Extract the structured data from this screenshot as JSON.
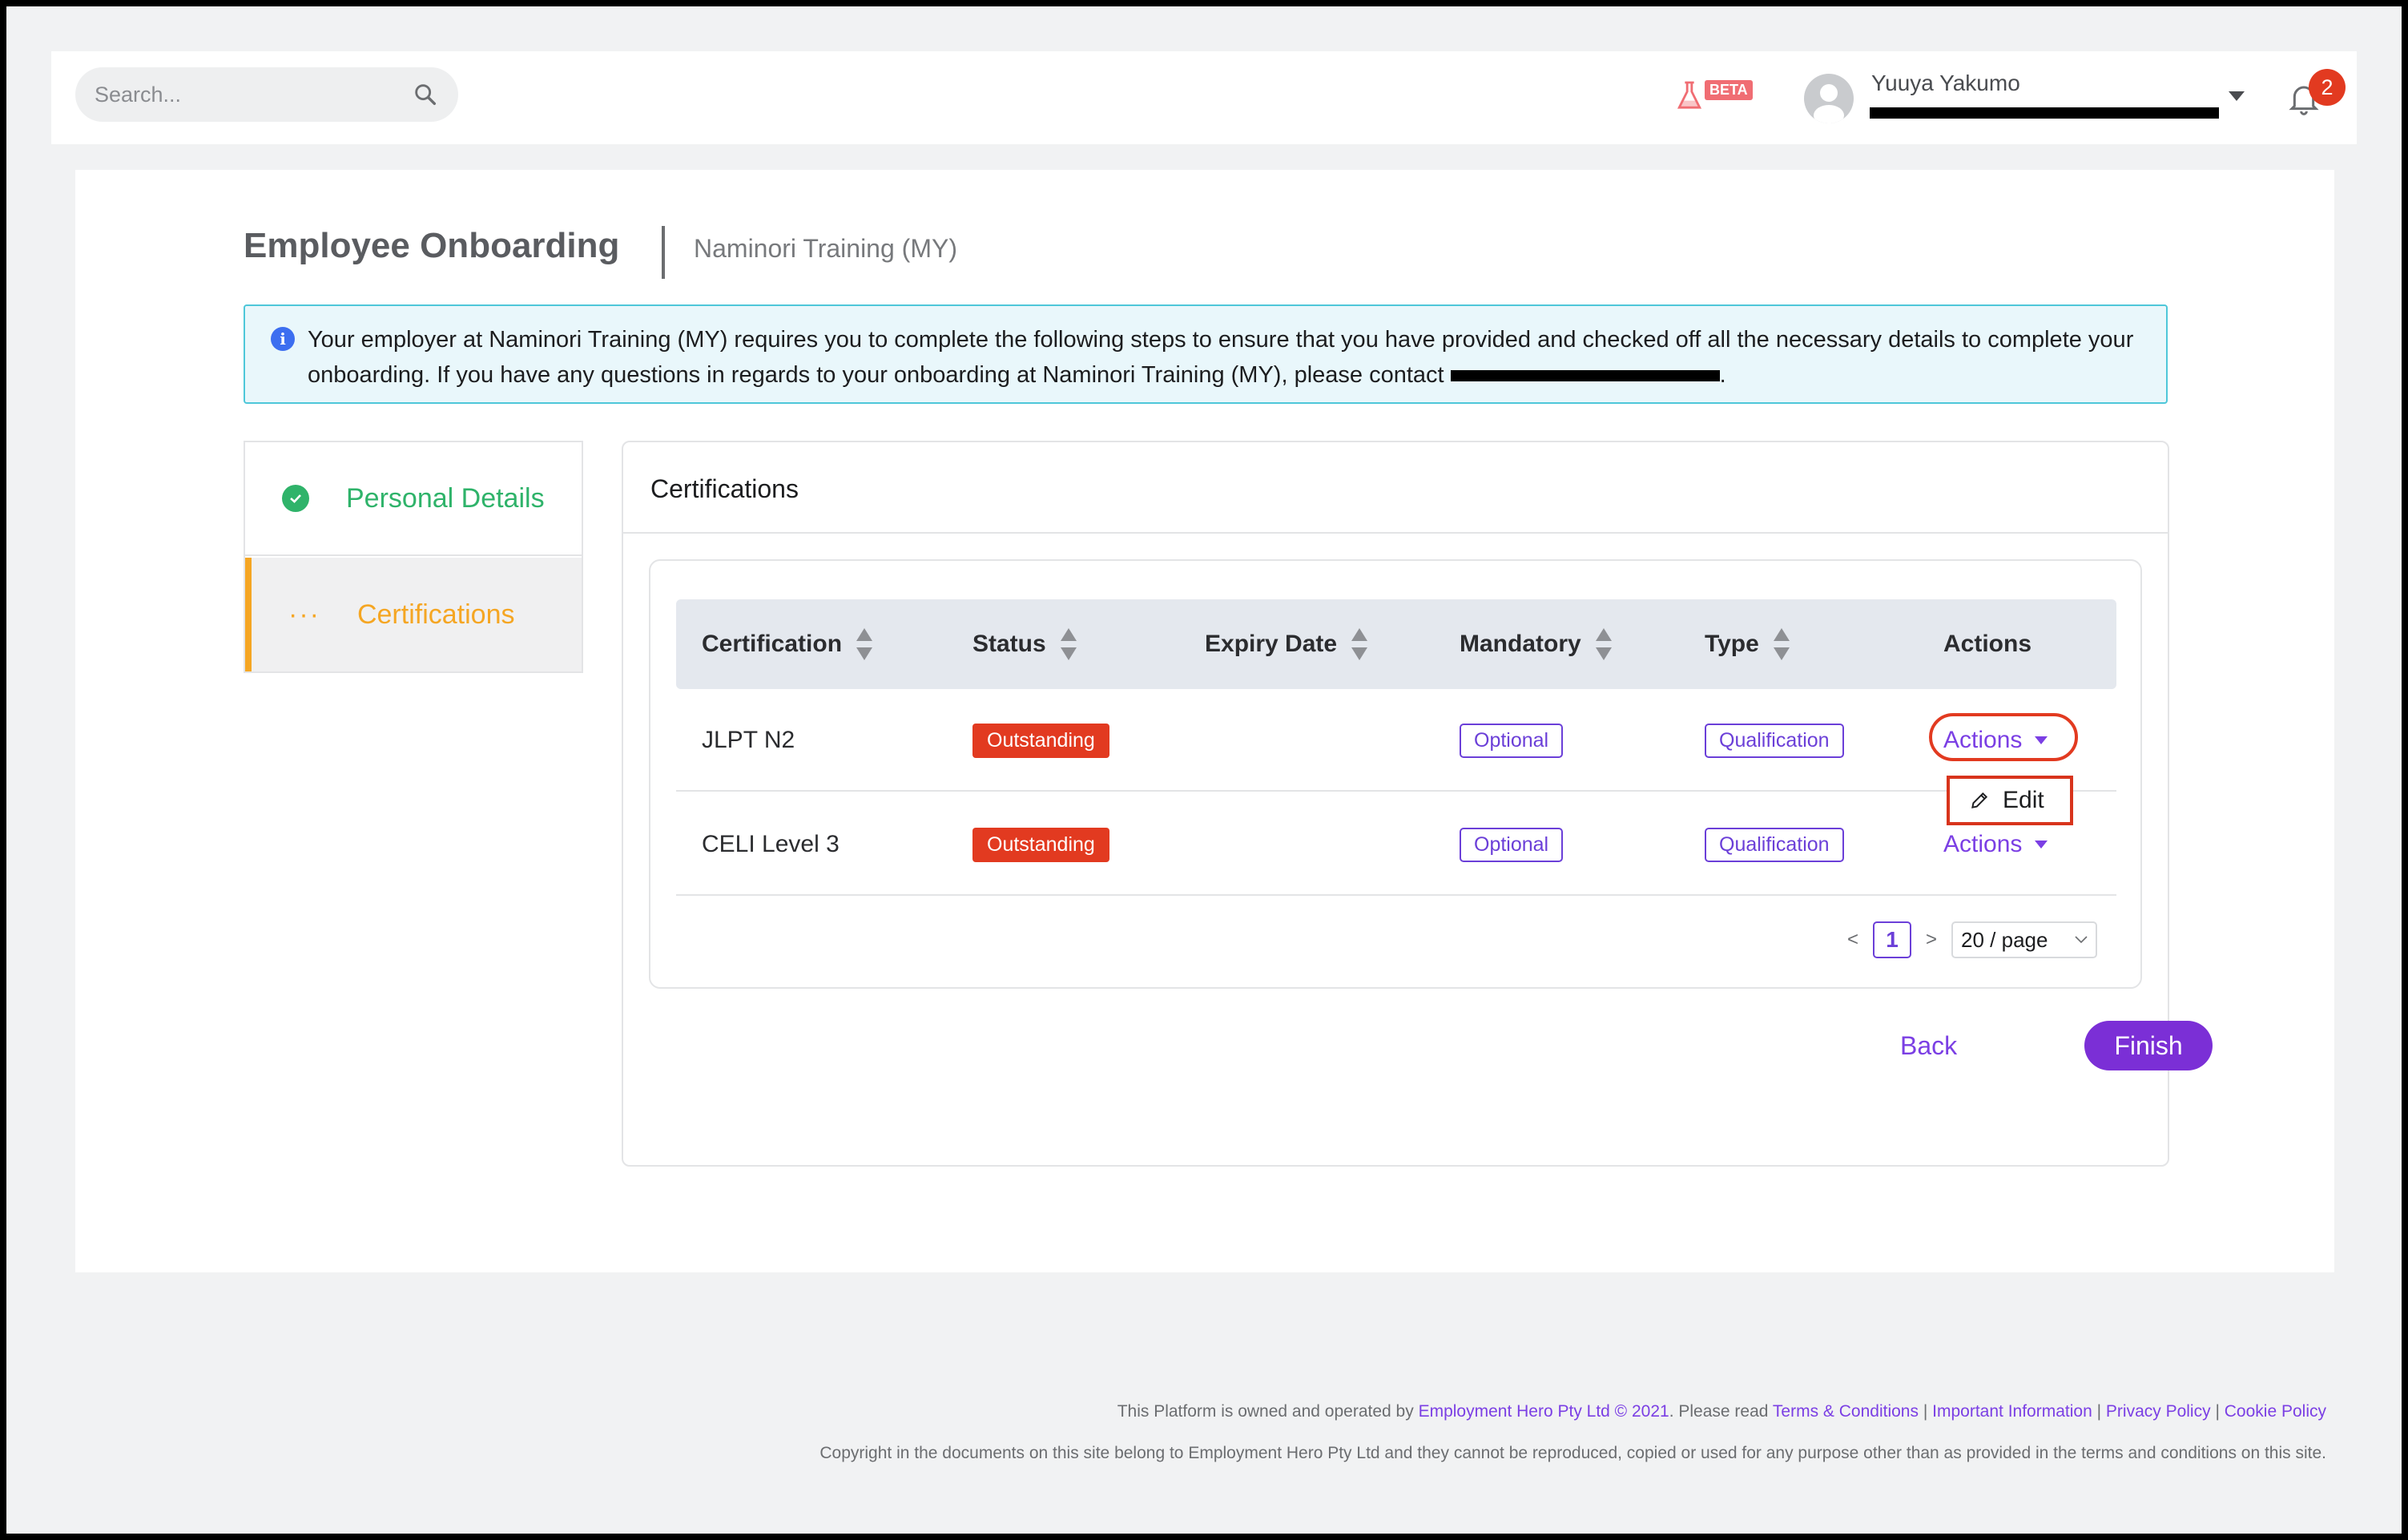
{
  "header": {
    "search_placeholder": "Search...",
    "beta_label": "BETA",
    "user_name": "Yuuya Yakumo",
    "notification_count": "2"
  },
  "page": {
    "title": "Employee Onboarding",
    "org": "Naminori Training (MY)",
    "info_text": "Your employer at Naminori Training (MY) requires you to complete the following steps to ensure that you have provided and checked off all the necessary details to complete your onboarding. If you have any questions in regards to your onboarding at Naminori Training (MY), please contact",
    "info_end": "."
  },
  "steps": [
    {
      "label": "Personal Details",
      "status": "done"
    },
    {
      "label": "Certifications",
      "status": "in-progress"
    }
  ],
  "certifications": {
    "title": "Certifications",
    "columns": [
      "Certification",
      "Status",
      "Expiry Date",
      "Mandatory",
      "Type",
      "Actions"
    ],
    "rows": [
      {
        "certification": "JLPT N2",
        "status": "Outstanding",
        "expiry": "",
        "mandatory": "Optional",
        "type": "Qualification",
        "actions": "Actions"
      },
      {
        "certification": "CELI Level 3",
        "status": "Outstanding",
        "expiry": "",
        "mandatory": "Optional",
        "type": "Qualification",
        "actions": "Actions"
      }
    ],
    "dropdown_item": "Edit",
    "pagination": {
      "prev": "<",
      "current": "1",
      "next": ">",
      "page_size": "20 / page"
    },
    "back_label": "Back",
    "finish_label": "Finish"
  },
  "footer": {
    "line1_prefix": "This Platform is owned and operated by",
    "company_link": "Employment Hero Pty Ltd © 2021",
    "please_read": ". Please read",
    "links": [
      "Terms & Conditions",
      "Important Information",
      "Privacy Policy",
      "Cookie Policy"
    ],
    "separator": "|",
    "copyright": "Copyright in the documents on this site belong to Employment Hero Pty Ltd and they cannot be reproduced, copied or used for any purpose other than as provided in the terms and conditions on this site."
  },
  "colors": {
    "accent": "#7b3fe4",
    "success": "#2fb36a",
    "warning": "#f5a623",
    "danger": "#e23a20"
  }
}
